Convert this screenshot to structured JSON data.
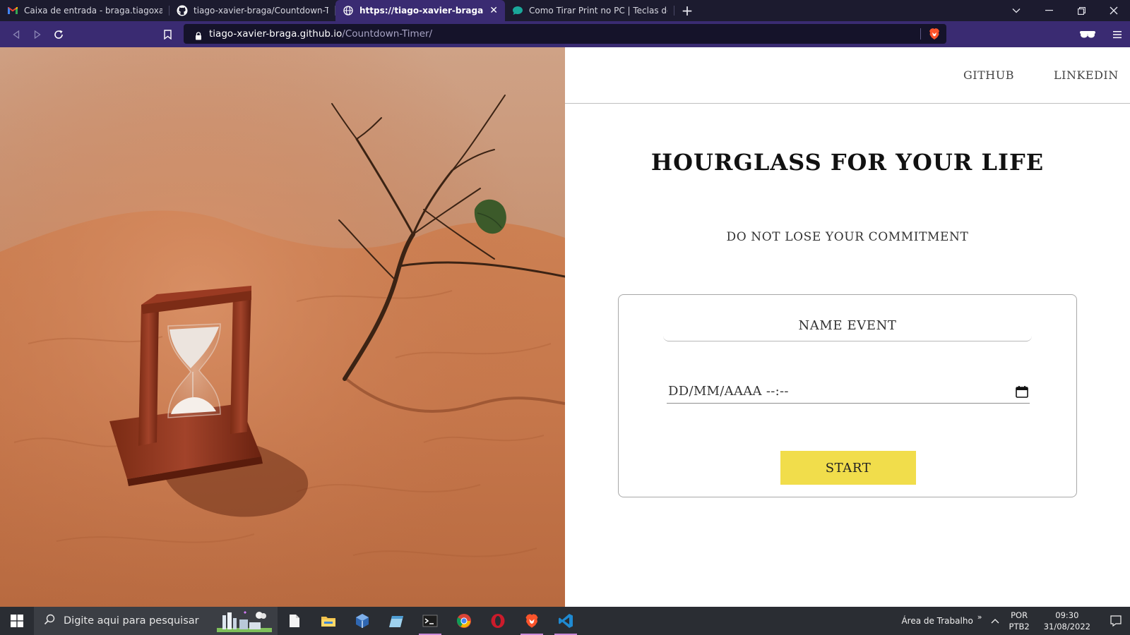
{
  "browser": {
    "tabs": [
      {
        "label": "Caixa de entrada - braga.tiagoxavier@",
        "icon": "gmail-icon",
        "active": false
      },
      {
        "label": "tiago-xavier-braga/Countdown-Timer",
        "icon": "github-icon",
        "active": false
      },
      {
        "label": "https://tiago-xavier-braga.github",
        "icon": "globe-icon",
        "active": true,
        "close": "✕"
      },
      {
        "label": "Como Tirar Print no PC | Teclas de Ata",
        "icon": "chat-bubble-icon",
        "active": false
      }
    ],
    "new_tab": "+",
    "address": {
      "host": "tiago-xavier-braga.github.io",
      "path": "/Countdown-Timer/"
    }
  },
  "site": {
    "nav": {
      "github": "GITHUB",
      "linkedin": "LINKEDIN"
    },
    "title": "HOURGLASS FOR YOUR LIFE",
    "subtitle": "DO NOT LOSE YOUR COMMITMENT",
    "form": {
      "name_placeholder": "NAME EVENT",
      "date_placeholder": "DD/MM/AAAA --:--",
      "start_label": "START"
    }
  },
  "taskbar": {
    "search_placeholder": "Digite aqui para pesquisar",
    "desktop_label": "Área de Trabalho",
    "more": "»",
    "language_top": "POR",
    "language_bottom": "PTB2",
    "time": "09:30",
    "date": "31/08/2022",
    "apps": [
      "file-icon",
      "folder-icon",
      "virtualbox-icon",
      "notepad-icon",
      "terminal-icon",
      "chrome-icon",
      "opera-icon",
      "brave-icon",
      "vscode-icon"
    ]
  },
  "colors": {
    "tabbar": "#1c1b2f",
    "toolbar": "#3a2b72",
    "start_button": "#f1dd4b",
    "sand": "#c9784a"
  }
}
